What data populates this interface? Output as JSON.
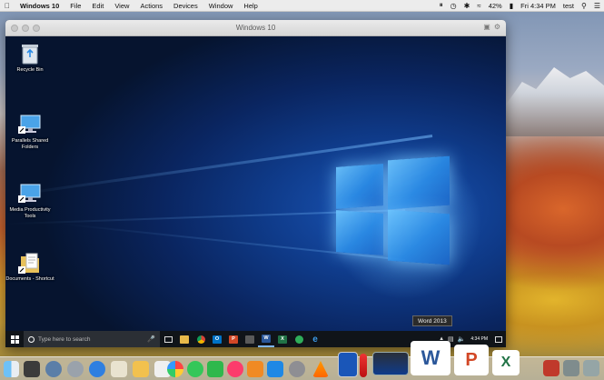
{
  "menubar": {
    "app_name": "Windows 10",
    "menus": [
      "File",
      "Edit",
      "View",
      "Actions",
      "Devices",
      "Window",
      "Help"
    ],
    "battery": "42%",
    "clock": "Fri 4:34 PM",
    "user": "test"
  },
  "vm_window": {
    "title": "Windows 10"
  },
  "desktop_icons": [
    {
      "label": "Recycle Bin"
    },
    {
      "label": "Parallels Shared Folders"
    },
    {
      "label": "Media Productivity Tools"
    },
    {
      "label": "Documents - Shortcut"
    }
  ],
  "taskbar": {
    "search_placeholder": "Type here to search",
    "clock_time": "4:34 PM"
  },
  "tooltip": "Word 2013",
  "colors": {
    "win_accent": "#2a8be6",
    "taskbar": "#101419",
    "word": "#2b579a",
    "powerpoint": "#d24726",
    "excel": "#217346",
    "outlook": "#0072c6"
  }
}
